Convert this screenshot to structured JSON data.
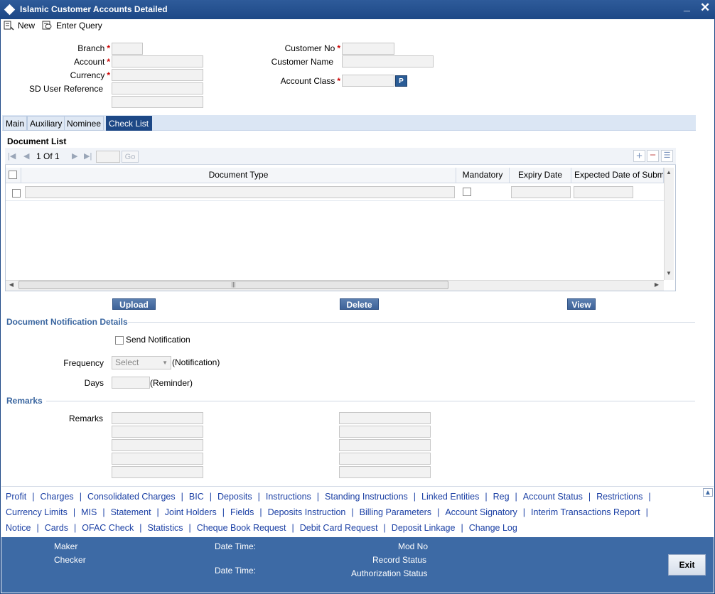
{
  "window": {
    "title": "Islamic Customer Accounts Detailed"
  },
  "toolbar": {
    "new_label": "New",
    "enter_query_label": "Enter Query"
  },
  "form": {
    "branch_label": "Branch",
    "account_label": "Account",
    "currency_label": "Currency",
    "sd_user_reference_label": "SD User Reference",
    "customer_no_label": "Customer No",
    "customer_name_label": "Customer Name",
    "account_class_label": "Account Class",
    "required_marker": "*",
    "lov_button_label": "P"
  },
  "tabs": [
    {
      "label": "Main"
    },
    {
      "label": "Auxiliary"
    },
    {
      "label": "Nominee"
    },
    {
      "label": "Check List"
    }
  ],
  "document_list": {
    "title": "Document List",
    "pager_text": "1 Of 1",
    "go_label": "Go",
    "columns": [
      "Document Type",
      "Mandatory",
      "Expiry Date",
      "Expected Date of Subm"
    ],
    "scroll_grip": "|||",
    "buttons": {
      "upload": "Upload",
      "delete": "Delete",
      "view": "View"
    }
  },
  "notification": {
    "title": "Document Notification Details",
    "send_notification_label": "Send Notification",
    "frequency_label": "Frequency",
    "frequency_value": "Select",
    "frequency_suffix": "(Notification)",
    "days_label": "Days",
    "days_suffix": "(Reminder)"
  },
  "remarks": {
    "title": "Remarks",
    "label": "Remarks"
  },
  "links": {
    "row1": [
      "Profit",
      "Charges",
      "Consolidated Charges",
      "BIC",
      "Deposits",
      "Instructions",
      "Standing Instructions",
      "Linked Entities",
      "Reg",
      "Account Status",
      "Restrictions"
    ],
    "row2": [
      "Currency Limits",
      "MIS",
      "Statement",
      "Joint Holders",
      "Fields",
      "Deposits Instruction",
      "Billing Parameters",
      "Account Signatory",
      "Interim Transactions Report"
    ],
    "row3": [
      "Notice",
      "Cards",
      "OFAC Check",
      "Statistics",
      "Cheque Book Request",
      "Debit Card Request",
      "Deposit Linkage",
      "Change Log"
    ],
    "separator": "|"
  },
  "footer": {
    "maker_label": "Maker",
    "checker_label": "Checker",
    "date_time_label": "Date Time:",
    "mod_no_label": "Mod No",
    "record_status_label": "Record Status",
    "authorization_status_label": "Authorization Status",
    "exit_label": "Exit"
  },
  "colors": {
    "title_bar": "#1d4886",
    "footer": "#3d6aa5",
    "link": "#1a3fa4",
    "section_header": "#3a66a0",
    "active_tab": "#1d4886"
  }
}
